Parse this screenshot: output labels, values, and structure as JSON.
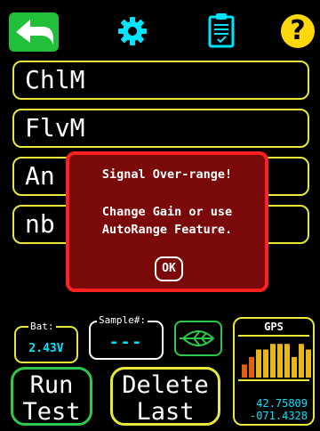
{
  "toolbar": {
    "back_icon": "back-arrow-icon",
    "settings_icon": "gear-icon",
    "notes_icon": "clipboard-icon",
    "help_label": "?",
    "colors": {
      "back": "#22bf3a",
      "settings": "#00e5ff",
      "help": "#ffd70a"
    }
  },
  "channels": [
    {
      "label": "ChlM"
    },
    {
      "label": "FlvM"
    },
    {
      "label": "An"
    },
    {
      "label": "nb"
    }
  ],
  "dialog": {
    "title": "Signal Over-range!",
    "line1": "Change Gain or use",
    "line2": "AutoRange Feature.",
    "ok_label": "OK"
  },
  "status": {
    "battery_label": "Bat:",
    "battery_value": "2.43V",
    "sample_label": "Sample#:",
    "sample_value": "---",
    "leaf_icon": "leaf-icon",
    "gps_label": "GPS",
    "gps_lat": "42.75809",
    "gps_lon": "-071.4328",
    "gps_signal_levels": [
      0.35,
      0.55,
      0.75,
      0.75,
      0.9,
      0.9,
      0.9,
      0.55,
      0.9,
      0.75
    ]
  },
  "actions": {
    "run_line1": "Run",
    "run_line2": "Test",
    "delete_line1": "Delete",
    "delete_line2": "Last"
  }
}
